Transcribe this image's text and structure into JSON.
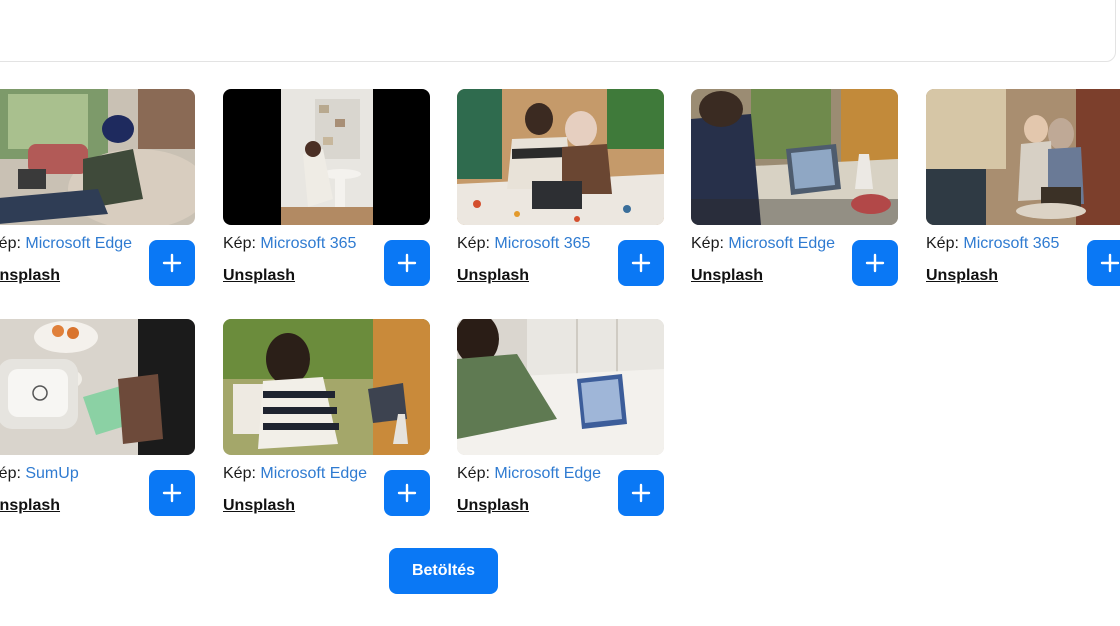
{
  "search": {
    "value": ""
  },
  "colors": {
    "accent": "#0a78f5",
    "link": "#2f7bd1"
  },
  "cards": [
    {
      "prefix": "Kép: ",
      "author": "Microsoft Edge",
      "source": "Unsplash",
      "image": "woman-on-sofa-with-laptop-photo",
      "add_icon": "plus-icon"
    },
    {
      "prefix": "Kép: ",
      "author": "Microsoft 365",
      "source": "Unsplash",
      "image": "person-in-white-room-photo",
      "add_icon": "plus-icon"
    },
    {
      "prefix": "Kép: ",
      "author": "Microsoft 365",
      "source": "Unsplash",
      "image": "two-women-at-laptop-photo",
      "add_icon": "plus-icon"
    },
    {
      "prefix": "Kép: ",
      "author": "Microsoft Edge",
      "source": "Unsplash",
      "image": "woman-with-tablet-photo",
      "add_icon": "plus-icon"
    },
    {
      "prefix": "Kép: ",
      "author": "Microsoft 365",
      "source": "Unsplash",
      "image": "two-women-at-cafe-photo",
      "add_icon": "plus-icon"
    },
    {
      "prefix": "Kép: ",
      "author": "SumUp",
      "source": "Unsplash",
      "image": "card-payment-terminal-photo",
      "add_icon": "plus-icon"
    },
    {
      "prefix": "Kép: ",
      "author": "Microsoft Edge",
      "source": "Unsplash",
      "image": "woman-striped-sweater-tablet-photo",
      "add_icon": "plus-icon"
    },
    {
      "prefix": "Kép: ",
      "author": "Microsoft Edge",
      "source": "Unsplash",
      "image": "man-in-bed-with-tablet-photo",
      "add_icon": "plus-icon"
    }
  ],
  "load_more": {
    "label": "Betöltés"
  }
}
